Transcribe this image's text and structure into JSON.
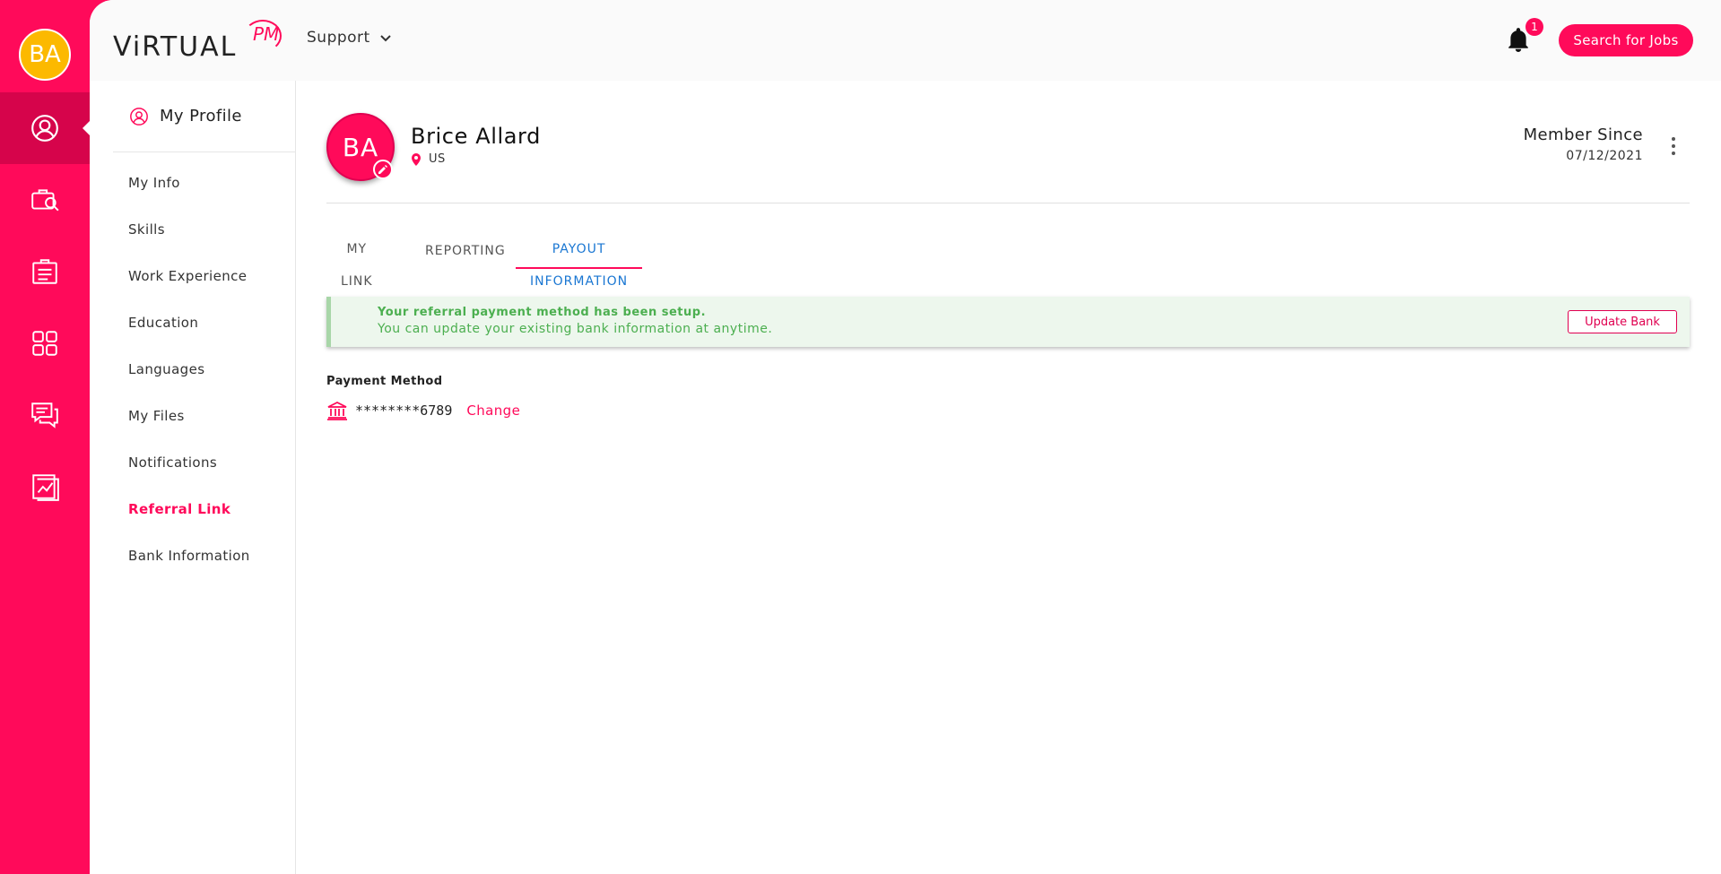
{
  "user": {
    "initials": "BA",
    "name": "Brice Allard",
    "location": "US"
  },
  "header": {
    "logo_text": "ViRTUAL",
    "logo_suffix": "PM",
    "support_label": "Support",
    "notification_count": "1",
    "search_jobs_label": "Search for Jobs"
  },
  "rail": {
    "items": [
      {
        "icon": "user-circle-icon",
        "active": true
      },
      {
        "icon": "briefcase-search-icon",
        "active": false
      },
      {
        "icon": "clipboard-icon",
        "active": false
      },
      {
        "icon": "grid-icon",
        "active": false
      },
      {
        "icon": "chat-icon",
        "active": false
      },
      {
        "icon": "report-chart-icon",
        "active": false
      }
    ]
  },
  "subnav": {
    "title": "My Profile",
    "items": [
      {
        "label": "My Info"
      },
      {
        "label": "Skills"
      },
      {
        "label": "Work Experience"
      },
      {
        "label": "Education"
      },
      {
        "label": "Languages"
      },
      {
        "label": "My Files"
      },
      {
        "label": "Notifications"
      },
      {
        "label": "Referral Link",
        "active": true
      },
      {
        "label": "Bank Information"
      }
    ]
  },
  "profile": {
    "member_since_label": "Member Since",
    "member_since_date": "07/12/2021"
  },
  "tabs": [
    {
      "label": "MY LINK"
    },
    {
      "label": "REPORTING"
    },
    {
      "label": "PAYOUT INFORMATION",
      "active": true
    }
  ],
  "alert": {
    "title": "Your referral payment method has been setup.",
    "text": "You can update your existing bank information at anytime.",
    "button": "Update Bank"
  },
  "payment": {
    "label": "Payment Method",
    "masked_account": "********6789",
    "change_label": "Change"
  },
  "colors": {
    "brand": "#ff0a5a",
    "avatar_rail": "#fcb900",
    "tab_active_text": "#1976d2",
    "success": "#4caf50"
  }
}
